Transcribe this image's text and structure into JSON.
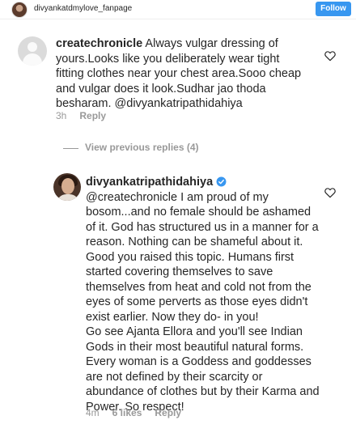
{
  "header": {
    "username": "divyankatdmylove_fanpage",
    "follow_label": "Follow"
  },
  "comments": [
    {
      "username": "createchronicle",
      "text": " Always vulgar dressing of yours.Looks like you deliberately wear tight fitting clothes near your chest area.Sooo cheap and vulgar does it look.Sudhar jao thoda besharam. @divyankatripathidahiya",
      "time": "3h",
      "reply_label": "Reply"
    },
    {
      "username": "divyankatripathidahiya",
      "verified": true,
      "text_p1": "@createchronicle I am proud of my bosom...and no female should be ashamed of it. God has structured us in a manner for a reason. Nothing can be shameful about it. Good you raised this topic. Humans first started covering themselves to save themselves from heat and cold not from the eyes of some perverts as those eyes didn't exist earlier. Now they do- in you!",
      "text_p2": "Go see Ajanta Ellora and you'll see Indian Gods in their most beautiful natural forms. Every woman is a Goddess and goddesses are not defined by their scarcity or abundance of clothes but by their Karma and Power. So respect!",
      "time": "4m",
      "likes": "6 likes",
      "reply_label": "Reply"
    }
  ],
  "view_replies_label": "View previous replies (4)",
  "colors": {
    "follow_bg": "#3897f0",
    "verified": "#3897f0",
    "meta_text": "#999999"
  },
  "icons": [
    "heart-icon",
    "verified-badge-icon",
    "default-avatar-icon"
  ]
}
